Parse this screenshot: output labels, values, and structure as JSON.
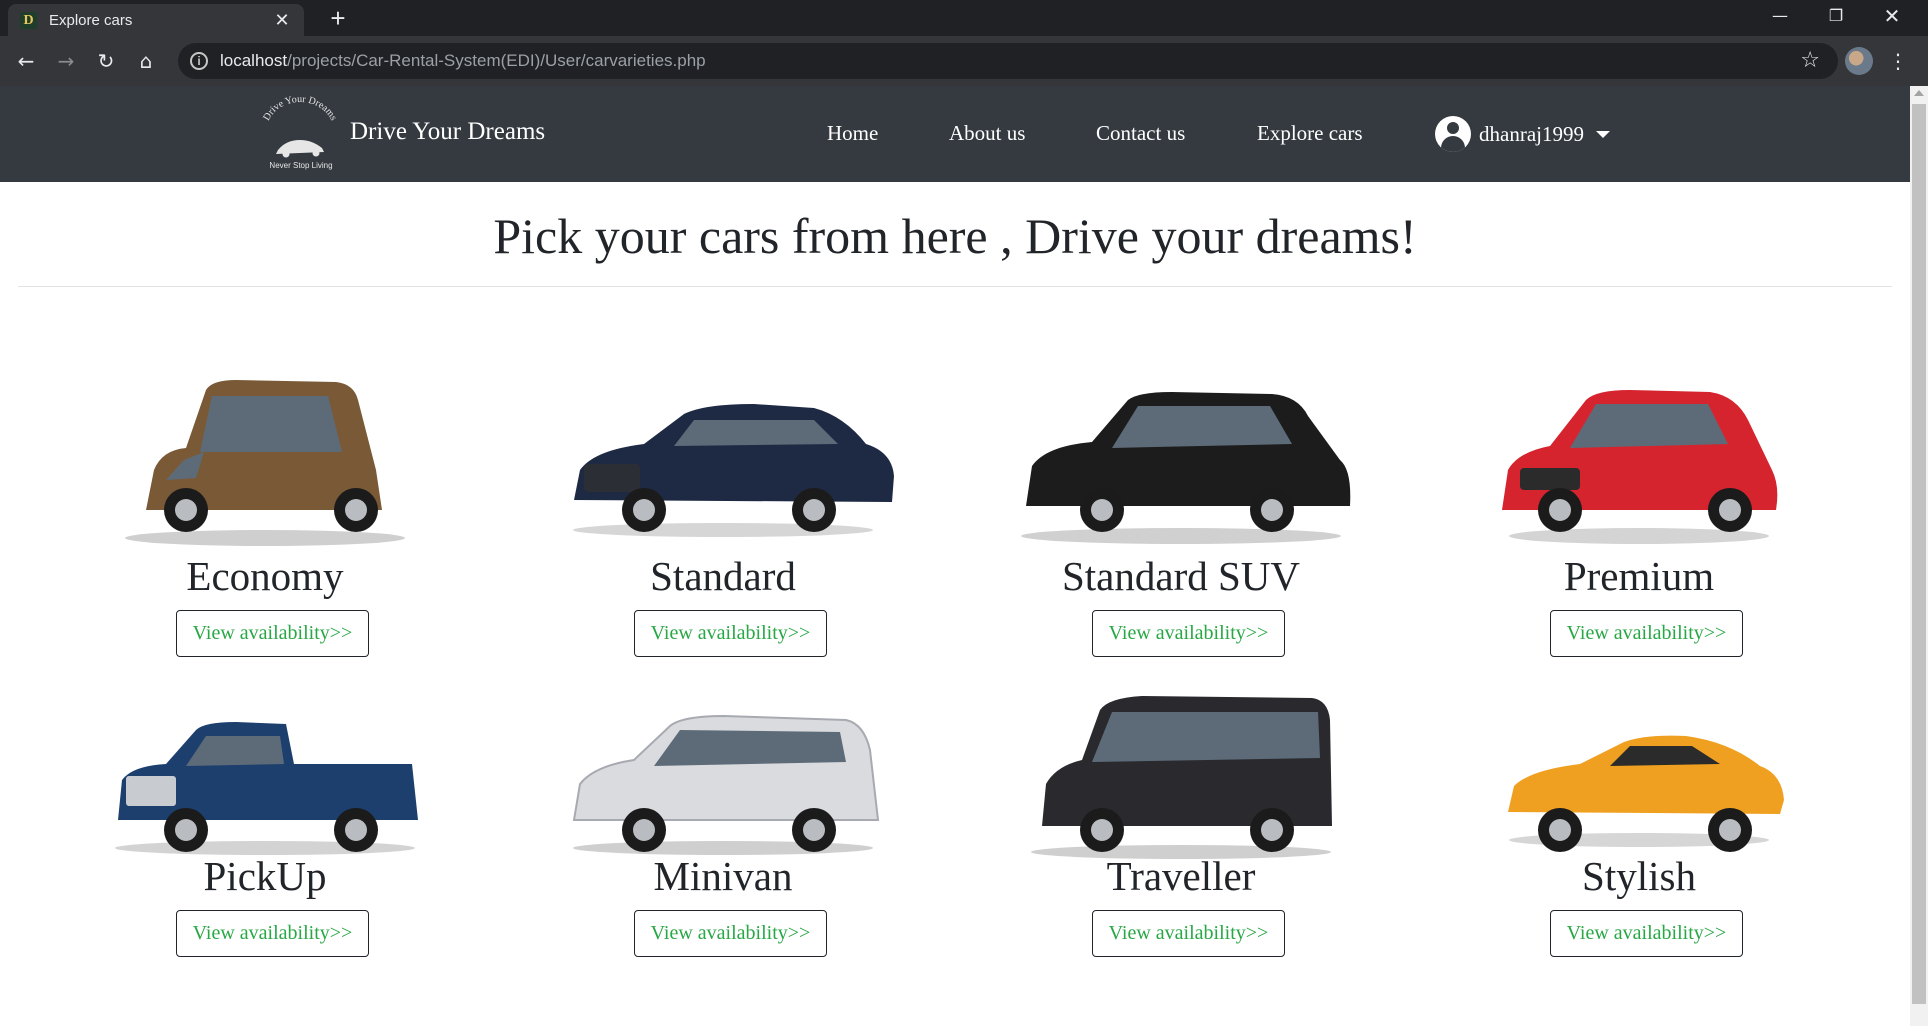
{
  "browser": {
    "tab_title": "Explore cars",
    "tab_favicon_letter": "D",
    "tab_close": "✕",
    "new_tab": "+",
    "url_host": "localhost",
    "url_path": "/projects/Car-Rental-System(EDI)/User/carvarieties.php",
    "info_icon": "i",
    "icons": {
      "back": "arrow-left-icon",
      "forward": "arrow-right-icon",
      "reload": "reload-icon",
      "home": "home-icon",
      "star": "star-icon",
      "menu": "kebab-menu-icon"
    }
  },
  "navbar": {
    "logo_arc_text": "Drive Your Dreams",
    "logo_tagline": "Never Stop Living",
    "brand": "Drive Your Dreams",
    "links": [
      "Home",
      "About us",
      "Contact us",
      "Explore cars"
    ],
    "username": "dhanraj1999",
    "colors": {
      "background": "#343a40",
      "text": "#ffffff"
    }
  },
  "page": {
    "title": "Pick your cars from here , Drive your dreams!"
  },
  "cars": [
    {
      "name": "Economy",
      "button": "View availability>>",
      "color": "#7a5a36",
      "shape": "hatch-tall"
    },
    {
      "name": "Standard",
      "button": "View availability>>",
      "color": "#1e2a44",
      "shape": "sedan"
    },
    {
      "name": "Standard SUV",
      "button": "View availability>>",
      "color": "#1c1c1c",
      "shape": "suv"
    },
    {
      "name": "Premium",
      "button": "View availability>>",
      "color": "#d6242f",
      "shape": "hatch"
    },
    {
      "name": "PickUp",
      "button": "View availability>>",
      "color": "#1d3f6e",
      "shape": "pickup"
    },
    {
      "name": "Minivan",
      "button": "View availability>>",
      "color": "#d9dbde",
      "shape": "minivan"
    },
    {
      "name": "Traveller",
      "button": "View availability>>",
      "color": "#2a2a2e",
      "shape": "van"
    },
    {
      "name": "Stylish",
      "button": "View availability>>",
      "color": "#f0a020",
      "shape": "sports"
    }
  ],
  "colors": {
    "button_text": "#28a745",
    "heading": "#212529"
  }
}
